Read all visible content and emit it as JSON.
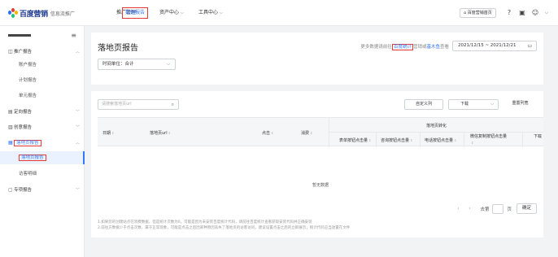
{
  "header": {
    "brand": "百度营销",
    "brand_sub": "信息流推广",
    "nav": [
      {
        "label": "推广管理"
      },
      {
        "label": "数据报告"
      },
      {
        "label": "资产中心"
      },
      {
        "label": "工具中心"
      }
    ],
    "home_button": "百度营销首页"
  },
  "sidebar": {
    "items": [
      {
        "label": "推广报告",
        "icon": "chart-icon",
        "expanded": true
      },
      {
        "label": "账户报告"
      },
      {
        "label": "计划报告"
      },
      {
        "label": "单元报告"
      },
      {
        "label": "定向报告",
        "icon": "target-icon"
      },
      {
        "label": "创意报告",
        "icon": "creative-icon"
      },
      {
        "label": "落地页报告",
        "icon": "landing-icon",
        "expanded": true
      },
      {
        "label": "落地页报告"
      },
      {
        "label": "访客明细"
      },
      {
        "label": "专项报告",
        "icon": "special-icon"
      }
    ]
  },
  "main": {
    "title": "落地页报告",
    "time_unit": "时间单位：合计",
    "hint_prefix": "更多数据请前往",
    "hint_link1": "百度统计",
    "hint_mid": "营销或",
    "hint_link2": "基木鱼",
    "hint_suffix": "查看",
    "date_range": "2021/12/15 ~ 2021/12/21"
  },
  "toolbar": {
    "search_placeholder": "请搜索落地页url",
    "custom_columns": "自定义列",
    "download": "下载",
    "reset_columns": "重置列宽"
  },
  "table": {
    "columns": [
      "日期",
      "落地页url",
      "点击",
      "消费"
    ],
    "group_header": "落地页转化",
    "group_columns": [
      "表单按钮点击量",
      "咨询按钮点击量",
      "电话按钮点击量",
      "微信复制按钮点击量",
      "下载"
    ],
    "empty_text": "暂无数据"
  },
  "pagination": {
    "goto_label": "去第",
    "page_label": "页",
    "confirm": "确定"
  },
  "notes": [
    "1.如果您的创建站点在消费数据，但是统计次数为0，可能是因为未安装百度统计代码，请前往百度统计查看获取安装代码并正确安装",
    "2.前往方数据少于点击次数，属于正常现象，可能是点击之后因某种原因丢失了落地页的访客访问，建议设置点击之后的立即展示，统计代码应当放置在文件"
  ],
  "colors": {
    "accent": "#3377ff",
    "highlight_box": "#e53935"
  }
}
